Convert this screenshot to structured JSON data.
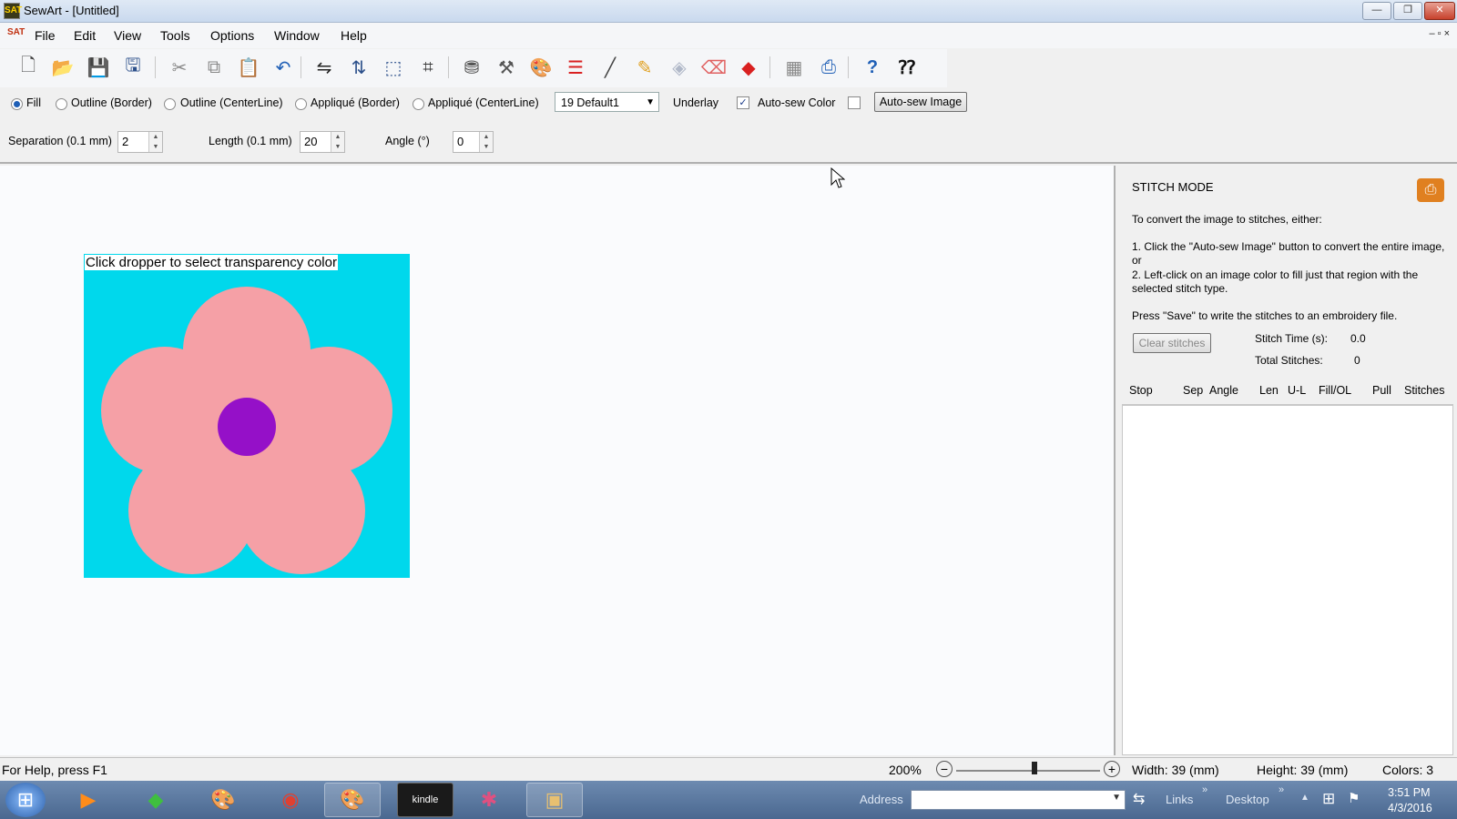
{
  "window": {
    "title": "SewArt - [Untitled]",
    "app_icon": "SAT",
    "controls": {
      "minimize": "—",
      "restore": "❐",
      "close": "✕"
    },
    "mdi_controls": "– ▫ ×"
  },
  "menu": {
    "icon": "SAT",
    "items": [
      "File",
      "Edit",
      "View",
      "Tools",
      "Options",
      "Window",
      "Help"
    ]
  },
  "toolbar": {
    "buttons": [
      {
        "name": "new-icon",
        "glyph": "🗋",
        "color": "#444444"
      },
      {
        "name": "open-icon",
        "glyph": "📂",
        "color": "#d9a520"
      },
      {
        "name": "save-icon",
        "glyph": "💾",
        "color": "#2b4f8a"
      },
      {
        "name": "save-as-icon",
        "glyph": "🖫",
        "color": "#2b4f8a"
      },
      {
        "name": "cut-icon",
        "glyph": "✂",
        "color": "#888888"
      },
      {
        "name": "copy-icon",
        "glyph": "⧉",
        "color": "#888888"
      },
      {
        "name": "paste-icon",
        "glyph": "📋",
        "color": "#8a6a2a"
      },
      {
        "name": "undo-icon",
        "glyph": "↶",
        "color": "#1f5fb6"
      },
      {
        "name": "mirror-horizontal-icon",
        "glyph": "⇋",
        "color": "#222222"
      },
      {
        "name": "mirror-vertical-icon",
        "glyph": "⇅",
        "color": "#2b4f8a"
      },
      {
        "name": "resize-icon",
        "glyph": "⬚",
        "color": "#2b4f8a"
      },
      {
        "name": "crop-icon",
        "glyph": "⌗",
        "color": "#333333"
      },
      {
        "name": "stamp-icon",
        "glyph": "⛃",
        "color": "#555555"
      },
      {
        "name": "tools-icon",
        "glyph": "⚒",
        "color": "#555555"
      },
      {
        "name": "palette-icon",
        "glyph": "🎨",
        "color": "#b58a3a"
      },
      {
        "name": "color-list-icon",
        "glyph": "☰",
        "color": "#d92020"
      },
      {
        "name": "pen-icon",
        "glyph": "╱",
        "color": "#444444"
      },
      {
        "name": "pencil-icon",
        "glyph": "✎",
        "color": "#e0a020"
      },
      {
        "name": "fill-icon",
        "glyph": "◈",
        "color": "#b0b8c8"
      },
      {
        "name": "eraser-icon",
        "glyph": "⌫",
        "color": "#e06060"
      },
      {
        "name": "shapes-icon",
        "glyph": "◆",
        "color": "#d92020"
      },
      {
        "name": "grid-icon",
        "glyph": "▦",
        "color": "#888888"
      },
      {
        "name": "sewing-machine-icon",
        "glyph": "⎙",
        "color": "#1f5fb6"
      },
      {
        "name": "help-icon",
        "glyph": "?",
        "color": "#1f5fb6"
      },
      {
        "name": "context-help-icon",
        "glyph": "⁇",
        "color": "#111111"
      }
    ]
  },
  "options": {
    "radios": [
      "Fill",
      "Outline (Border)",
      "Outline (CenterLine)",
      "Appliqué (Border)",
      "Appliqué (CenterLine)"
    ],
    "selected_radio": 0,
    "thread_select": "19 Default1",
    "underlay_label": "Underlay",
    "autosew_color_label": "Auto-sew Color",
    "autosew_color_checked": true,
    "autosew_image_label": "Auto-sew Image",
    "checkmark": "✓"
  },
  "params": {
    "separation_label": "Separation (0.1 mm)",
    "separation_value": "2",
    "length_label": "Length (0.1 mm)",
    "length_value": "20",
    "angle_label": "Angle (°)",
    "angle_value": "0"
  },
  "canvas": {
    "hint": "Click dropper to select transparency color",
    "colors": {
      "background": "#00d8ec",
      "petal": "#f5a0a6",
      "center": "#9510c8"
    }
  },
  "panel": {
    "title": "STITCH MODE",
    "intro": "To convert the image to stitches, either:",
    "step1": "1. Click the \"Auto-sew Image\" button to convert the entire image, or",
    "step2": "2. Left-click on an image color to fill just that region with the selected stitch type.",
    "save_note": "Press \"Save\" to write the stitches to an embroidery file.",
    "clear_button": "Clear stitches",
    "stitch_time_label": "Stitch Time (s):",
    "stitch_time_value": "0.0",
    "total_stitches_label": "Total Stitches:",
    "total_stitches_value": "0",
    "columns": [
      "Stop",
      "Sep",
      "Angle",
      "Len",
      "U-L",
      "Fill/OL",
      "Pull",
      "Stitches"
    ]
  },
  "status": {
    "help": "For Help, press F1",
    "zoom": "200%",
    "zoom_out": "−",
    "zoom_in": "+",
    "width": "Width: 39 (mm)",
    "height": "Height: 39 (mm)",
    "colors": "Colors: 3"
  },
  "taskbar": {
    "start_glyph": "⊞",
    "apps": [
      {
        "name": "media-player-icon",
        "glyph": "▶",
        "color": "#ff8c1a"
      },
      {
        "name": "sims-icon",
        "glyph": "◆",
        "color": "#3fbf3f"
      },
      {
        "name": "paint-icon",
        "glyph": "🎨",
        "color": "#f0e0b0"
      },
      {
        "name": "chrome-icon",
        "glyph": "◉",
        "color": "#e04030"
      },
      {
        "name": "sewart-icon",
        "glyph": "🎨",
        "color": "#f0c000"
      },
      {
        "name": "kindle-icon",
        "glyph": "kindle",
        "color": "#ffffff"
      },
      {
        "name": "picasa-icon",
        "glyph": "✱",
        "color": "#e05080"
      },
      {
        "name": "photo-viewer-icon",
        "glyph": "▣",
        "color": "#e8c070"
      }
    ],
    "address_label": "Address",
    "links_label": "Links",
    "desktop_label": "Desktop",
    "chevron": "»",
    "time": "3:51 PM",
    "date": "4/3/2016"
  }
}
